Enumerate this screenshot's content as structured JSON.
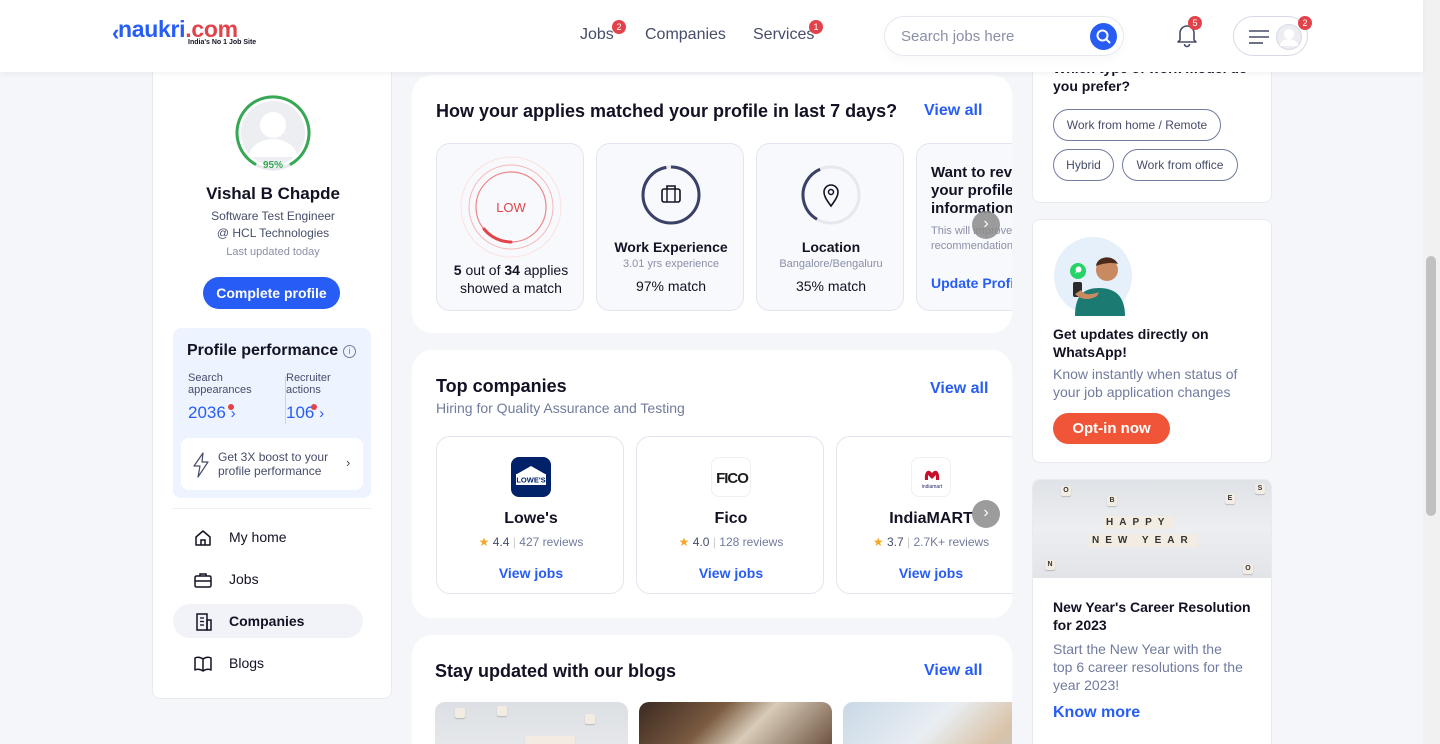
{
  "header": {
    "logo_text": "naukri",
    "logo_dot": ".com",
    "logo_tagline": "India's No 1 Job Site",
    "nav": [
      {
        "label": "Jobs",
        "badge": "2"
      },
      {
        "label": "Companies",
        "badge": ""
      },
      {
        "label": "Services",
        "badge": "1"
      }
    ],
    "search_placeholder": "Search jobs here",
    "notification_count": "5",
    "menu_badge": "2"
  },
  "profile": {
    "completion": "95%",
    "name": "Vishal B Chapde",
    "designation": "Software Test Engineer",
    "company": "@ HCL Technologies",
    "updated": "Last updated today",
    "complete_button": "Complete profile",
    "performance": {
      "title": "Profile performance",
      "search_label_1": "Search",
      "search_label_2": "appearances",
      "search_value": "2036",
      "recruiter_label_1": "Recruiter",
      "recruiter_label_2": "actions",
      "recruiter_value": "106",
      "boost_text": "Get 3X boost to your profile performance"
    }
  },
  "side_menu": [
    {
      "label": "My home",
      "icon": "home-icon"
    },
    {
      "label": "Jobs",
      "icon": "briefcase-icon"
    },
    {
      "label": "Companies",
      "icon": "building-icon"
    },
    {
      "label": "Blogs",
      "icon": "book-icon"
    }
  ],
  "matches": {
    "title": "How your applies matched your profile in last 7 days?",
    "view_all": "View all",
    "low_label": "LOW",
    "applies_count": "5",
    "applies_total": "34",
    "applies_text_1": "out of",
    "applies_text_2": "applies",
    "applies_text_3": "showed a match",
    "experience": {
      "title": "Work Experience",
      "sub": "3.01 yrs experience",
      "value": "97% match"
    },
    "location": {
      "title": "Location",
      "sub": "Bangalore/Bengaluru",
      "value": "35% match"
    },
    "review": {
      "title": "Want to review your profile information",
      "sub": "This will improve your job recommendations",
      "link": "Update Profile"
    }
  },
  "companies": {
    "title": "Top companies",
    "subtitle": "Hiring for Quality Assurance and Testing",
    "view_all": "View all",
    "items": [
      {
        "name": "Lowe's",
        "rating": "4.4",
        "reviews": "427 reviews",
        "link": "View jobs",
        "logo_text": "LOWE'S"
      },
      {
        "name": "Fico",
        "rating": "4.0",
        "reviews": "128 reviews",
        "link": "View jobs",
        "logo_text": "FICO"
      },
      {
        "name": "IndiaMART",
        "rating": "3.7",
        "reviews": "2.7K+ reviews",
        "link": "View jobs",
        "logo_text": "indiamart"
      }
    ]
  },
  "blogs": {
    "title": "Stay updated with our blogs",
    "view_all": "View all"
  },
  "work_model": {
    "title": "Which type of work model do you prefer?",
    "options": [
      "Work from home / Remote",
      "Hybrid",
      "Work from office"
    ]
  },
  "whatsapp": {
    "title": "Get updates directly on WhatsApp!",
    "desc": "Know instantly when status of your job application changes",
    "button": "Opt-in now"
  },
  "blog_promo": {
    "img_text_1": "HAPPY",
    "img_text_2": "NEW YEAR",
    "title": "New Year's Career Resolution for 2023",
    "desc": "Start the New Year with the top 6 career resolutions for the year 2023!",
    "link": "Know more"
  },
  "colors": {
    "accent": "#275df5",
    "badge": "#e2434b",
    "optin": "#f05537",
    "success": "#34a853"
  }
}
